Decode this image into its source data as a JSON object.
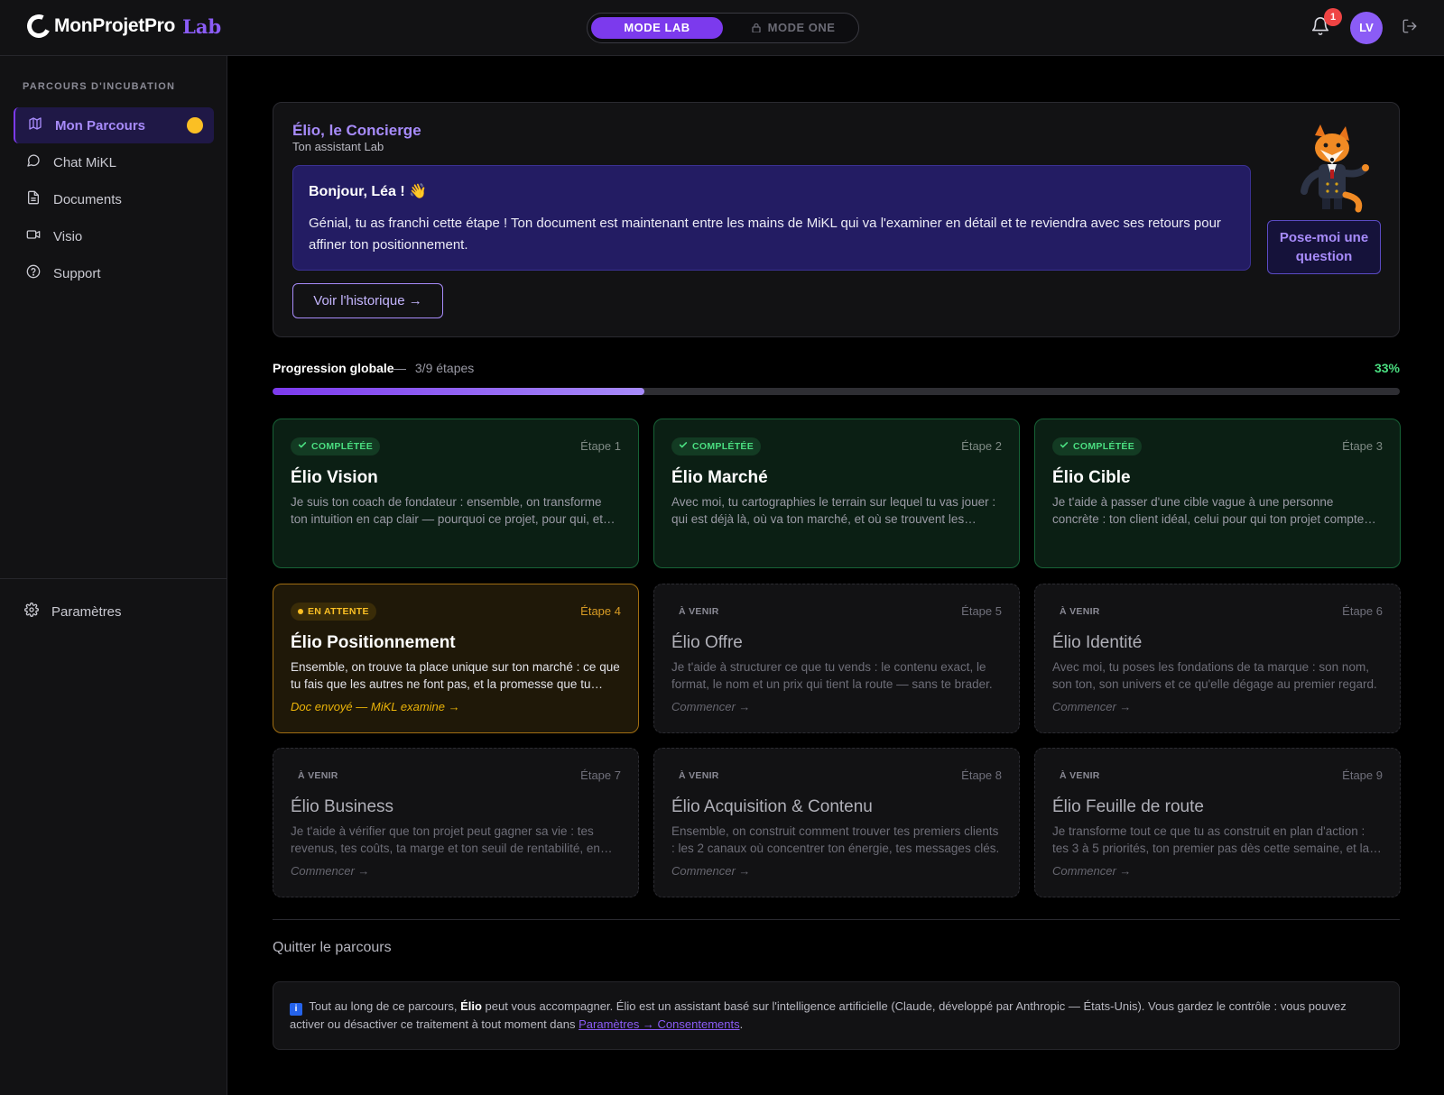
{
  "header": {
    "brand": "MonProjetPro",
    "brand_suffix": "Lab",
    "mode_lab": "MODE LAB",
    "mode_one": "MODE ONE",
    "notification_count": "1",
    "avatar_initials": "LV"
  },
  "sidebar": {
    "section_title": "PARCOURS D'INCUBATION",
    "items": [
      {
        "label": "Mon Parcours",
        "icon": "map-icon",
        "active": true
      },
      {
        "label": "Chat MiKL",
        "icon": "chat-icon"
      },
      {
        "label": "Documents",
        "icon": "document-icon"
      },
      {
        "label": "Visio",
        "icon": "video-icon"
      },
      {
        "label": "Support",
        "icon": "help-icon"
      }
    ],
    "settings_label": "Paramètres"
  },
  "concierge": {
    "name": "Élio, le Concierge",
    "subtitle": "Ton assistant Lab",
    "greeting": "Bonjour, Léa ! 👋",
    "message": "Génial, tu as franchi cette étape ! Ton document est maintenant entre les mains de MiKL qui va l'examiner en détail et te reviendra avec ses retours pour affiner ton positionnement.",
    "history_button": "Voir l'historique →",
    "ask_button": "Pose-moi une question"
  },
  "progress": {
    "label": "Progression globale",
    "separator": "—",
    "steps": "3/9 étapes",
    "percent_label": "33%",
    "fraction": 0.33
  },
  "steps": [
    {
      "status": "done",
      "badge": "COMPLÉTÉE",
      "step": "Étape 1",
      "title": "Élio Vision",
      "desc": "Je suis ton coach de fondateur : ensemble, on transforme ton intuition en cap clair — pourquoi ce projet, pour qui, et vers où.",
      "foot": ""
    },
    {
      "status": "done",
      "badge": "COMPLÉTÉE",
      "step": "Étape 2",
      "title": "Élio Marché",
      "desc": "Avec moi, tu cartographies le terrain sur lequel tu vas jouer : qui est déjà là, où va ton marché, et où se trouvent les opportunités.",
      "foot": ""
    },
    {
      "status": "done",
      "badge": "COMPLÉTÉE",
      "step": "Étape 3",
      "title": "Élio Cible",
      "desc": "Je t'aide à passer d'une cible vague à une personne concrète : ton client idéal, celui pour qui ton projet compte vraiment.",
      "foot": ""
    },
    {
      "status": "wait",
      "badge": "EN ATTENTE",
      "step": "Étape 4",
      "title": "Élio Positionnement",
      "desc": "Ensemble, on trouve ta place unique sur ton marché : ce que tu fais que les autres ne font pas, et la promesse que tu portes.",
      "foot": "Doc envoyé — MiKL examine →"
    },
    {
      "status": "up",
      "badge": "À VENIR",
      "step": "Étape 5",
      "title": "Élio Offre",
      "desc": "Je t'aide à structurer ce que tu vends : le contenu exact, le format, le nom et un prix qui tient la route — sans te brader.",
      "foot": "Commencer →"
    },
    {
      "status": "up",
      "badge": "À VENIR",
      "step": "Étape 6",
      "title": "Élio Identité",
      "desc": "Avec moi, tu poses les fondations de ta marque : son nom, son ton, son univers et ce qu'elle dégage au premier regard.",
      "foot": "Commencer →"
    },
    {
      "status": "up",
      "badge": "À VENIR",
      "step": "Étape 7",
      "title": "Élio Business",
      "desc": "Je t'aide à vérifier que ton projet peut gagner sa vie : tes revenus, tes coûts, ta marge et ton seuil de rentabilité, en clair.",
      "foot": "Commencer →"
    },
    {
      "status": "up",
      "badge": "À VENIR",
      "step": "Étape 8",
      "title": "Élio Acquisition & Contenu",
      "desc": "Ensemble, on construit comment trouver tes premiers clients : les 2 canaux où concentrer ton énergie, tes messages clés.",
      "foot": "Commencer →"
    },
    {
      "status": "up",
      "badge": "À VENIR",
      "step": "Étape 9",
      "title": "Élio Feuille de route",
      "desc": "Je transforme tout ce que tu as construit en plan d'action : tes 3 à 5 priorités, ton premier pas dès cette semaine, et la suite.",
      "foot": "Commencer →"
    }
  ],
  "footer": {
    "quit": "Quitter le parcours",
    "info_pre": "Tout au long de ce parcours,",
    "info_bold": "Élio",
    "info_post": "peut vous accompagner. Élio est un assistant basé sur l'intelligence artificielle (Claude, développé par Anthropic — États-Unis). Vous gardez le contrôle : vous pouvez activer ou désactiver ce traitement à tout moment dans",
    "info_link": "Paramètres → Consentements",
    "info_end": "."
  },
  "colors": {
    "accent": "#7c3aed",
    "done": "#4ade80",
    "waiting": "#fbbf24",
    "badge": "#ef4444"
  }
}
